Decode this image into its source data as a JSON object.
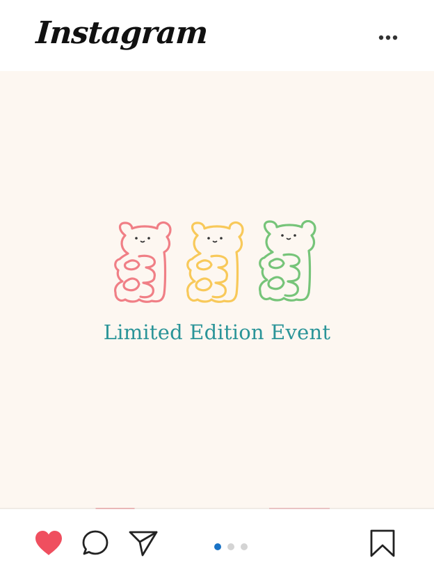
{
  "app": {
    "logo_text": "Instagram"
  },
  "header": {
    "more_icon": "more-horizontal-icon"
  },
  "post": {
    "caption": "Limited Edition Event",
    "bear_colors": [
      "#f07f86",
      "#f8c95a",
      "#76c479"
    ],
    "background_color": "#fdf7f1",
    "caption_color": "#2a9498"
  },
  "actions": {
    "like_icon": "heart-icon",
    "like_color": "#ef4f5f",
    "comment_icon": "comment-icon",
    "share_icon": "send-icon",
    "save_icon": "bookmark-icon"
  },
  "carousel": {
    "total": 3,
    "current": 1,
    "active_color": "#1a73c6"
  }
}
